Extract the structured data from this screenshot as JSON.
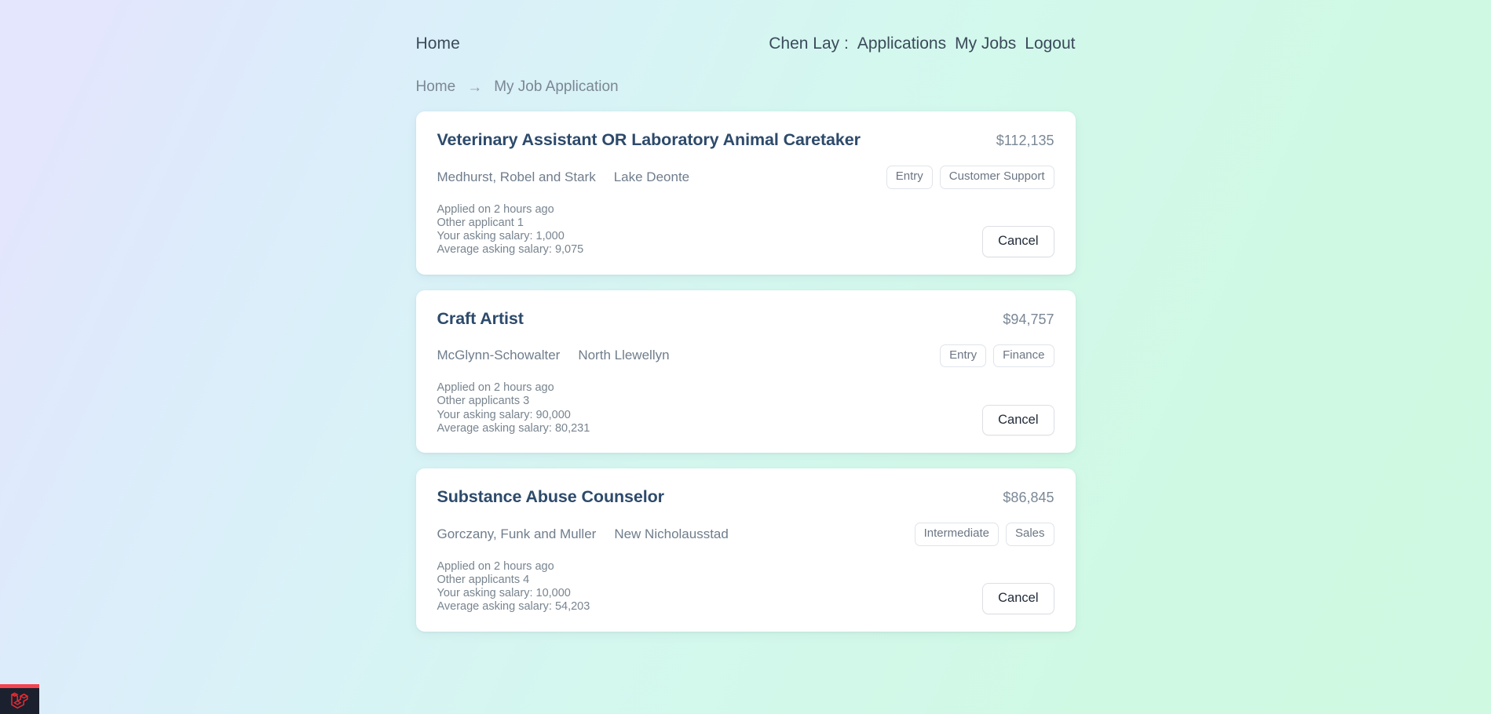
{
  "nav": {
    "brand": "Home",
    "user_label": "Chen Lay :",
    "applications_label": "Applications",
    "my_jobs_label": "My Jobs",
    "logout_label": "Logout"
  },
  "breadcrumb": {
    "home": "Home",
    "arrow": "→",
    "current": "My Job Application"
  },
  "cards": [
    {
      "title": "Veterinary Assistant OR Laboratory Animal Caretaker",
      "salary": "$112,135",
      "company": "Medhurst, Robel and Stark",
      "location": "Lake Deonte",
      "tags": [
        "Entry",
        "Customer Support"
      ],
      "applied": "Applied on 2 hours ago",
      "applicants": "Other applicant 1",
      "your_salary": "Your asking salary: 1,000",
      "average_salary": "Average asking salary: 9,075",
      "cancel_label": "Cancel"
    },
    {
      "title": "Craft Artist",
      "salary": "$94,757",
      "company": "McGlynn-Schowalter",
      "location": "North Llewellyn",
      "tags": [
        "Entry",
        "Finance"
      ],
      "applied": "Applied on 2 hours ago",
      "applicants": "Other applicants 3",
      "your_salary": "Your asking salary: 90,000",
      "average_salary": "Average asking salary: 80,231",
      "cancel_label": "Cancel"
    },
    {
      "title": "Substance Abuse Counselor",
      "salary": "$86,845",
      "company": "Gorczany, Funk and Muller",
      "location": "New Nicholausstad",
      "tags": [
        "Intermediate",
        "Sales"
      ],
      "applied": "Applied on 2 hours ago",
      "applicants": "Other applicants 4",
      "your_salary": "Your asking salary: 10,000",
      "average_salary": "Average asking salary: 54,203",
      "cancel_label": "Cancel"
    }
  ],
  "debugbar": {
    "icon": "laravel-logo-icon",
    "bar_color": "#f4434f",
    "bg_color": "#1a202e"
  },
  "theme": {
    "gradient_start": "#e3e6fd",
    "gradient_end": "#cff9e1",
    "title_color": "#2d4a6b",
    "muted_color": "#78848f"
  }
}
